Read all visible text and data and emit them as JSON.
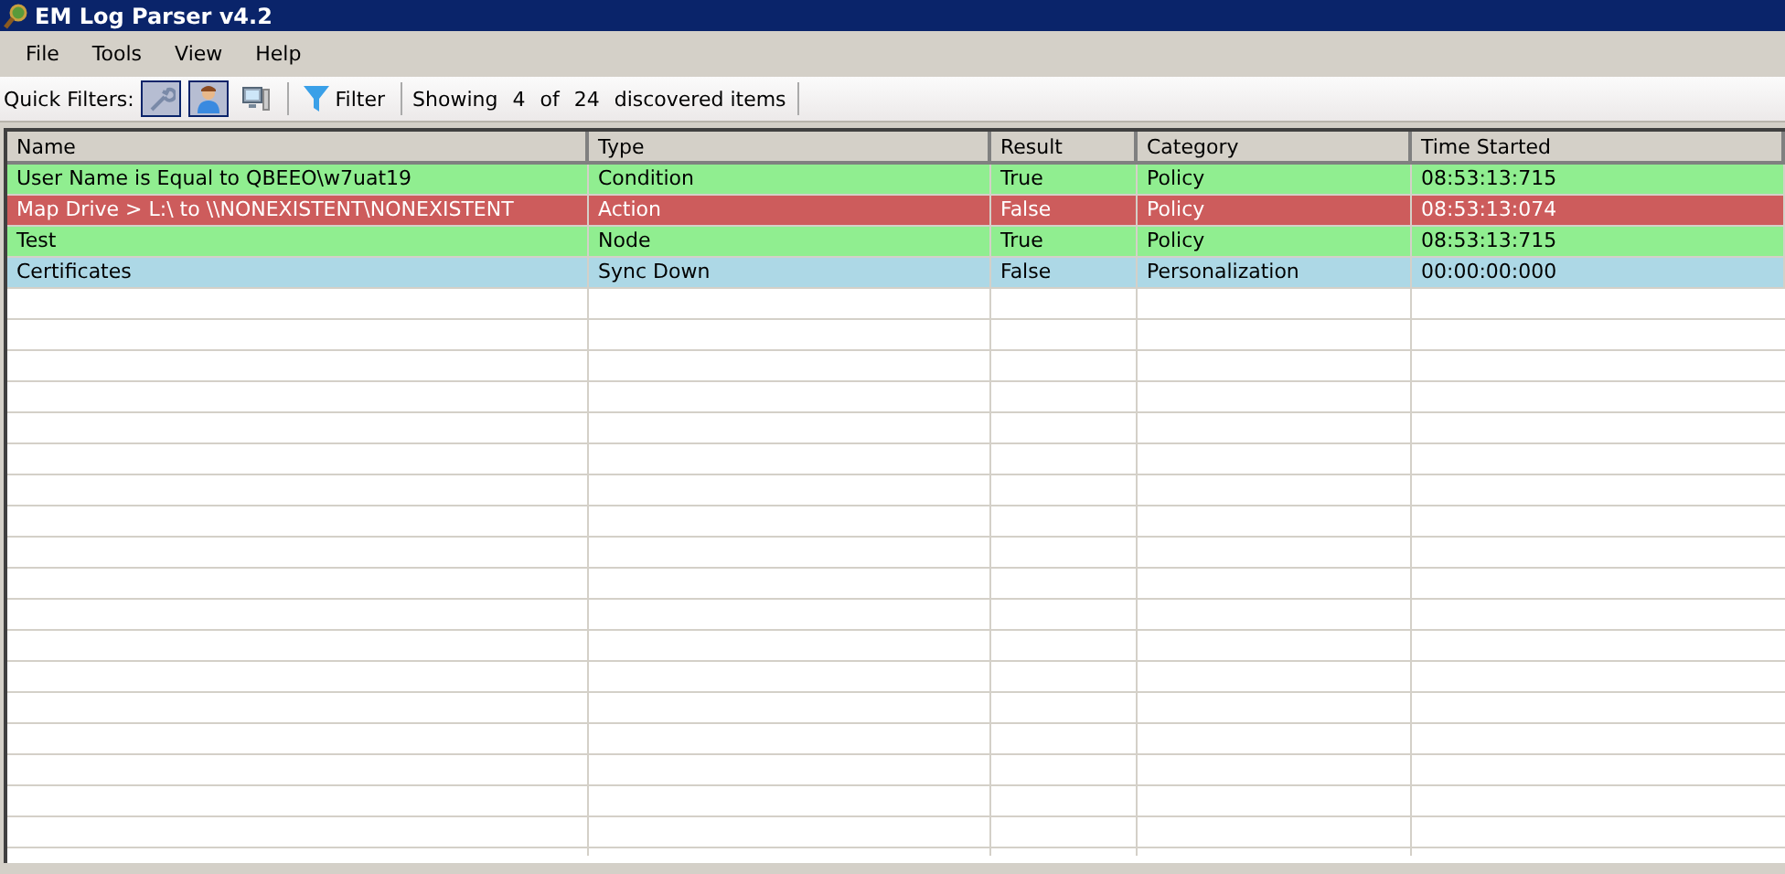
{
  "window": {
    "title": "EM Log Parser v4.2"
  },
  "menu": [
    "File",
    "Tools",
    "View",
    "Help"
  ],
  "toolbar": {
    "quick_filters_label": "Quick Filters:",
    "quick_filters": [
      {
        "kind": "wrench",
        "selected": true
      },
      {
        "kind": "user",
        "selected": true
      },
      {
        "kind": "computer",
        "selected": false
      }
    ],
    "filter_button": "Filter",
    "showing": [
      "Showing",
      "4",
      "of",
      "24",
      "discovered items"
    ]
  },
  "table": {
    "columns": [
      "Name",
      "Type",
      "Result",
      "Category",
      "Time Started"
    ],
    "rows": [
      {
        "color": "#90ee90",
        "cells": [
          "User Name is Equal to QBEEO\\w7uat19",
          "Condition",
          "True",
          "Policy",
          "08:53:13:715"
        ]
      },
      {
        "color": "#cd5c5c",
        "cells": [
          "Map Drive > L:\\ to \\\\NONEXISTENT\\NONEXISTENT",
          "Action",
          "False",
          "Policy",
          "08:53:13:074"
        ]
      },
      {
        "color": "#90ee90",
        "cells": [
          "Test",
          "Node",
          "True",
          "Policy",
          "08:53:13:715"
        ]
      },
      {
        "color": "#add8e6",
        "cells": [
          "Certificates",
          "Sync Down",
          "False",
          "Personalization",
          "00:00:00:000"
        ]
      }
    ]
  }
}
